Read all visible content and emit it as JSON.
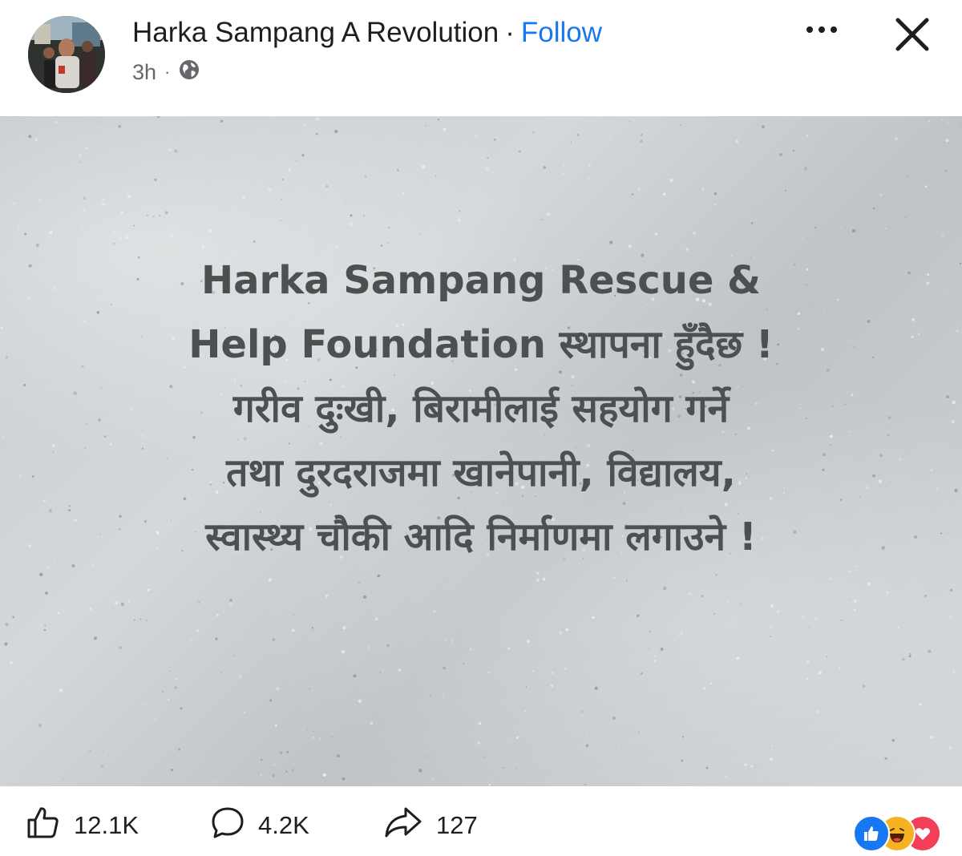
{
  "header": {
    "page_name": "Harka Sampang A Revolution",
    "separator": "·",
    "follow_label": "Follow",
    "time": "3h",
    "meta_separator": "·",
    "privacy_icon": "globe-icon",
    "more_icon": "more-horizontal-icon",
    "close_icon": "close-icon"
  },
  "post": {
    "image_lines": [
      "Harka Sampang Rescue &",
      "Help Foundation स्थापना हुँदैछ !",
      "गरीव दुःखी, बिरामीलाई सहयोग गर्ने",
      "तथा दुरदराजमा खानेपानी, विद्यालय,",
      "स्वास्थ्य चौकी आदि निर्माणमा लगाउने !"
    ],
    "background_color": "#c9cdd0",
    "text_color": "#4e4f50"
  },
  "actions": {
    "likes": "12.1K",
    "comments": "4.2K",
    "shares": "127",
    "like_icon": "thumbs-up-icon",
    "comment_icon": "comment-bubble-icon",
    "share_icon": "share-arrow-icon"
  },
  "reactions": [
    {
      "name": "like",
      "icon": "like-reaction-icon",
      "color": "#1877f2"
    },
    {
      "name": "haha",
      "icon": "haha-reaction-icon",
      "color": "#f7b125"
    },
    {
      "name": "love",
      "icon": "love-reaction-icon",
      "color": "#f33e58"
    }
  ],
  "colors": {
    "accent": "#1877f2",
    "secondary_text": "#65676b"
  }
}
